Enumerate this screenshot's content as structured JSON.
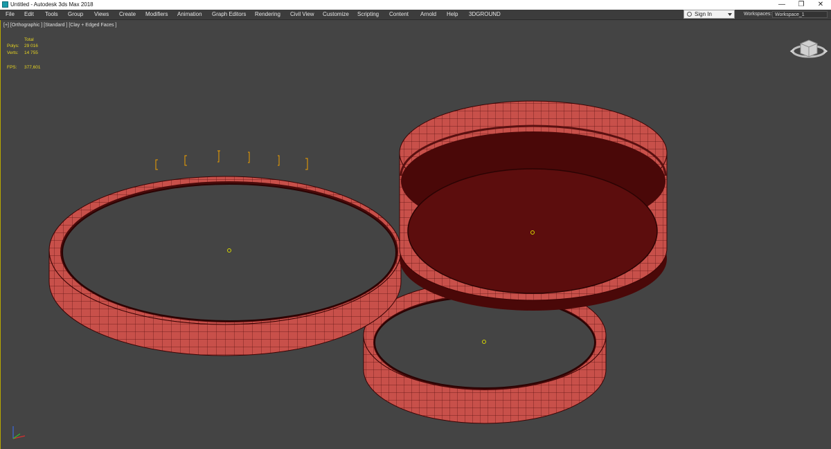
{
  "window": {
    "title": "Untitled - Autodesk 3ds Max 2018",
    "controls": {
      "minimize": "—",
      "restore": "❐",
      "close": "✕"
    }
  },
  "menu": {
    "items": [
      "File",
      "Edit",
      "Tools",
      "Group",
      "Views",
      "Create",
      "Modifiers",
      "Animation",
      "Graph Editors",
      "Rendering",
      "Civil View",
      "Customize",
      "Scripting",
      "Content",
      "Arnold",
      "Help",
      "3DGROUND"
    ]
  },
  "account": {
    "sign_in": "Sign In"
  },
  "workspace": {
    "label": "Workspaces:",
    "value": "Workspace_1"
  },
  "viewport": {
    "label": "[+] [Orthographic ] [Standard ] [Clay + Edged Faces ]",
    "stats": {
      "header": "Total",
      "polys_label": "Polys:",
      "polys_value": "29 016",
      "verts_label": "Verts:",
      "verts_value": "14 755",
      "fps_label": "FPS:",
      "fps_value": "377,601"
    }
  },
  "colors": {
    "viewport_bg": "#444444",
    "mesh_face": "#c8504a",
    "mesh_dark": "#5a0c0c",
    "stat_text": "#e8d520",
    "pivot": "#d8d800"
  },
  "icons": {
    "app": "3ds-max-app-icon",
    "viewcube": "viewcube-icon",
    "axis_tripod": "axis-tripod-icon"
  }
}
